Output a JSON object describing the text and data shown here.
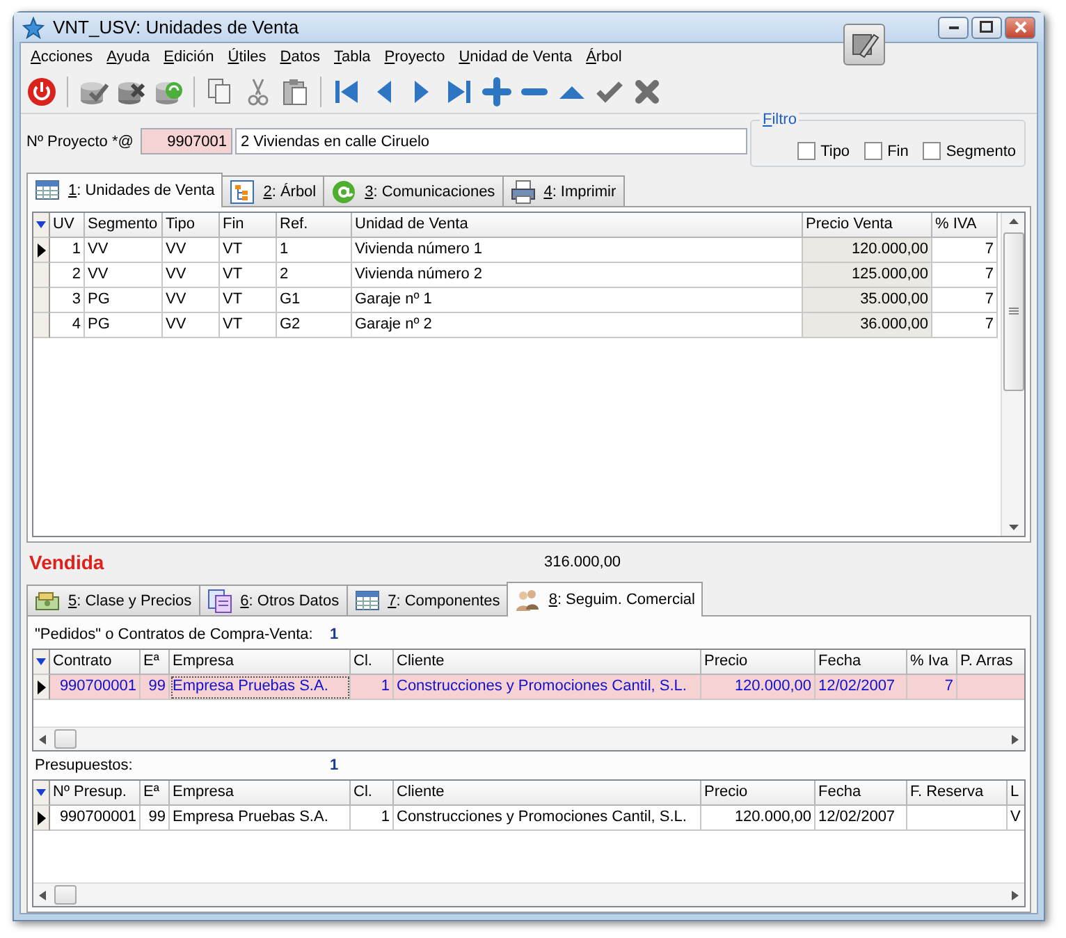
{
  "window": {
    "title": "VNT_USV: Unidades de Venta"
  },
  "menu": [
    {
      "key": "A",
      "rest": "cciones"
    },
    {
      "key": "A",
      "rest": "yuda"
    },
    {
      "key": "E",
      "rest": "dición"
    },
    {
      "key": "Ú",
      "rest": "tiles"
    },
    {
      "key": "D",
      "rest": "atos"
    },
    {
      "key": "T",
      "rest": "abla"
    },
    {
      "key": "P",
      "rest": "royecto"
    },
    {
      "key": "U",
      "rest": "nidad de Venta"
    },
    {
      "key": "Á",
      "rest": "rbol"
    }
  ],
  "project": {
    "label": "Nº Proyecto *@",
    "code": "9907001",
    "name": "2 Viviendas en calle Ciruelo"
  },
  "filter": {
    "title": {
      "key": "F",
      "rest": "iltro"
    },
    "options": [
      {
        "label": "Tipo",
        "checked": false
      },
      {
        "label": "Fin",
        "checked": false
      },
      {
        "label": "Segmento",
        "checked": false
      }
    ]
  },
  "tabs": [
    {
      "key": "1",
      "rest": ": Unidades de Venta",
      "selected": true
    },
    {
      "key": "2",
      "rest": ": Árbol",
      "selected": false
    },
    {
      "key": "3",
      "rest": ": Comunicaciones",
      "selected": false
    },
    {
      "key": "4",
      "rest": ": Imprimir",
      "selected": false
    }
  ],
  "units_grid": {
    "columns": [
      {
        "label": "UV",
        "shaded": false
      },
      {
        "label": "Segmento",
        "shaded": false
      },
      {
        "label": "Tipo",
        "shaded": false
      },
      {
        "label": "Fin",
        "shaded": false
      },
      {
        "label": "Ref.",
        "shaded": false
      },
      {
        "label": "Unidad de Venta",
        "shaded": false
      },
      {
        "label": "Precio Venta",
        "shaded": true
      },
      {
        "label": "% IVA",
        "shaded": false
      }
    ],
    "rows": [
      {
        "current": true,
        "cells": [
          "1",
          "VV",
          "VV",
          "VT",
          "1",
          "Vivienda número 1",
          "120.000,00",
          "7"
        ]
      },
      {
        "current": false,
        "cells": [
          "2",
          "VV",
          "VV",
          "VT",
          "2",
          "Vivienda número 2",
          "125.000,00",
          "7"
        ]
      },
      {
        "current": false,
        "cells": [
          "3",
          "PG",
          "VV",
          "VT",
          "G1",
          "Garaje nº 1",
          "35.000,00",
          "7"
        ]
      },
      {
        "current": false,
        "cells": [
          "4",
          "PG",
          "VV",
          "VT",
          "G2",
          "Garaje nº 2",
          "36.000,00",
          "7"
        ]
      }
    ]
  },
  "status": {
    "state": "Vendida",
    "total": "316.000,00"
  },
  "tabs2": [
    {
      "key": "5",
      "rest": ": Clase y Precios",
      "selected": false
    },
    {
      "key": "6",
      "rest": ": Otros Datos",
      "selected": false
    },
    {
      "key": "7",
      "rest": ": Componentes",
      "selected": false
    },
    {
      "key": "8",
      "rest": ": Seguim. Comercial",
      "selected": true
    }
  ],
  "contracts": {
    "label": "\"Pedidos\" o Contratos de Compra-Venta:",
    "count": "1",
    "columns": [
      {
        "label": "Contrato"
      },
      {
        "label": "Eª"
      },
      {
        "label": "Empresa"
      },
      {
        "label": "Cl."
      },
      {
        "label": "Cliente"
      },
      {
        "label": "Precio"
      },
      {
        "label": "Fecha"
      },
      {
        "label": "% Iva"
      },
      {
        "label": "P. Arras"
      }
    ],
    "rows": [
      {
        "current": true,
        "selected": true,
        "cells": [
          "990700001",
          "99",
          "Empresa Pruebas S.A.",
          "1",
          "Construcciones y Promociones Cantil, S.L.",
          "120.000,00",
          "12/02/2007",
          "7",
          ""
        ]
      }
    ]
  },
  "budgets": {
    "label": "Presupuestos:",
    "count": "1",
    "columns": [
      {
        "label": "Nº Presup."
      },
      {
        "label": "Eª"
      },
      {
        "label": "Empresa"
      },
      {
        "label": "Cl."
      },
      {
        "label": "Cliente"
      },
      {
        "label": "Precio"
      },
      {
        "label": "Fecha"
      },
      {
        "label": "F. Reserva"
      },
      {
        "label": "L"
      }
    ],
    "rows": [
      {
        "current": true,
        "cells": [
          "990700001",
          "99",
          "Empresa Pruebas S.A.",
          "1",
          "Construcciones y Promociones Cantil, S.L.",
          "120.000,00",
          "12/02/2007",
          "",
          "V"
        ]
      }
    ]
  }
}
